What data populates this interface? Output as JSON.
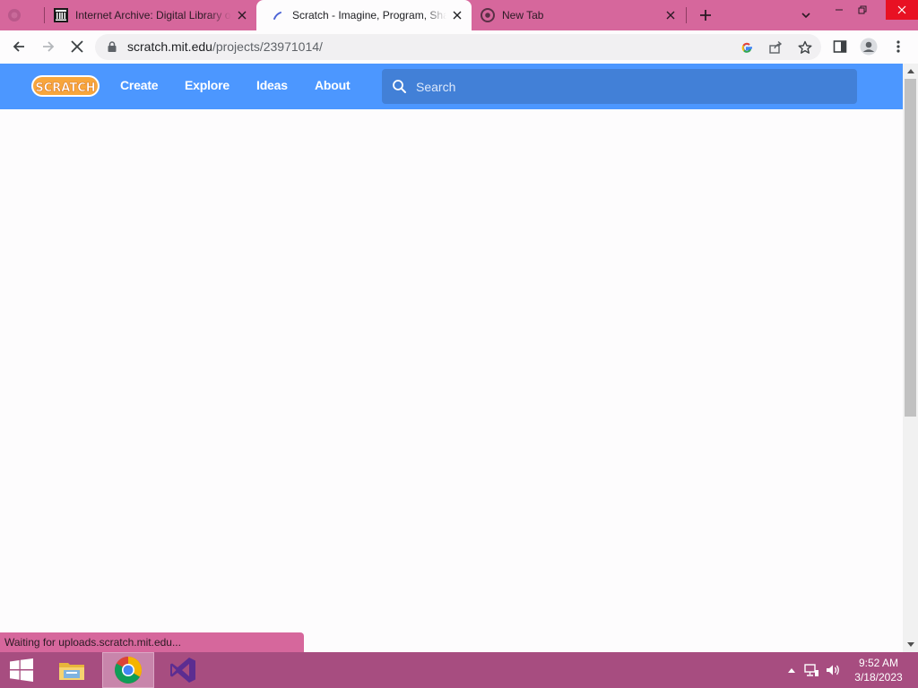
{
  "browser": {
    "tabs": [
      {
        "title": "Internet Archive: Digital Library of Free & Borrowable Books, Movies, Music & Wayback Machine",
        "favicon": "internet-archive-icon"
      },
      {
        "title": "Scratch - Imagine, Program, Share",
        "favicon": "scratch-cat-icon",
        "active": true
      },
      {
        "title": "New Tab",
        "favicon": "chrome-icon"
      }
    ],
    "address_bar": {
      "host": "scratch.mit.edu",
      "path": "/projects/23971014/"
    },
    "status_text": "Waiting for uploads.scratch.mit.edu..."
  },
  "scratch": {
    "logo_text": "SCRATCH",
    "nav": {
      "create": "Create",
      "explore": "Explore",
      "ideas": "Ideas",
      "about": "About"
    },
    "search_placeholder": "Search"
  },
  "taskbar": {
    "time": "9:52 AM",
    "date": "3/18/2023"
  },
  "colors": {
    "tab_strip": "#d6679c",
    "scratch_blue": "#4c97ff",
    "search_bg": "#4280d7",
    "taskbar": "#a74d80",
    "logo_orange": "#f8a63c"
  }
}
